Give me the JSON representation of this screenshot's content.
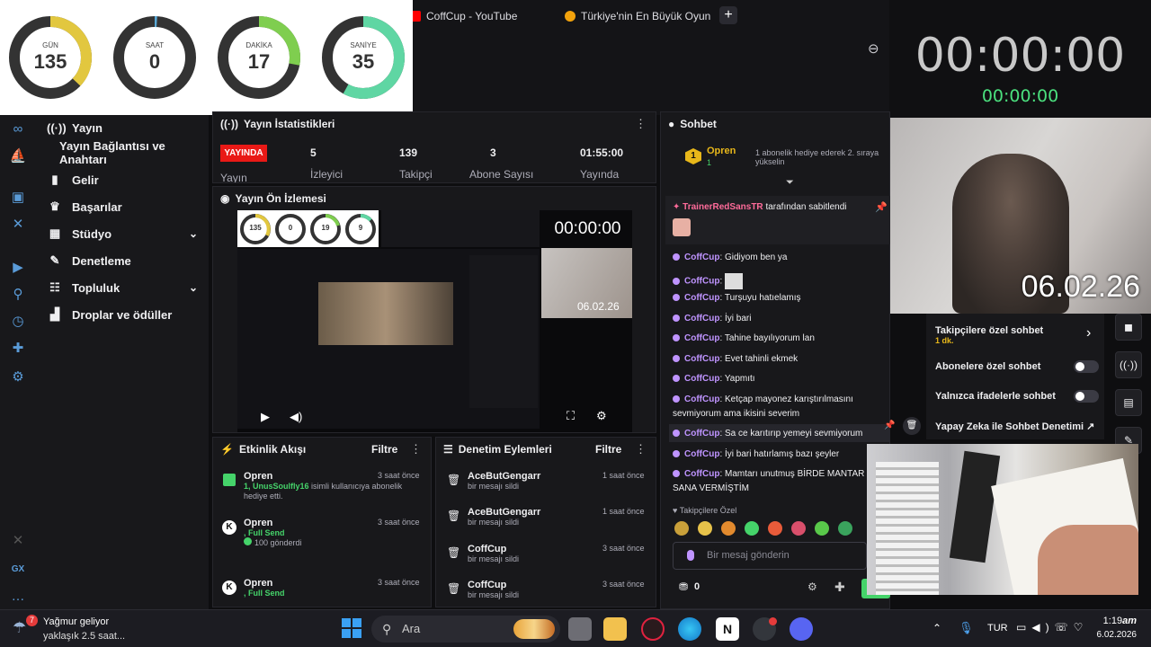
{
  "browser": {
    "tabs": [
      {
        "label": "CoffCup - YouTube",
        "favicon_color": "#ff0000"
      },
      {
        "label": "Türkiye'nin En Büyük Oyun",
        "favicon_color": "#f2a20c"
      }
    ],
    "new_tab": "+",
    "zoom_icon": "zoom-out-icon"
  },
  "countdown": {
    "items": [
      {
        "label": "GÜN",
        "value": "135",
        "fraction": 0.37,
        "color": "#e2c73f"
      },
      {
        "label": "SAAT",
        "value": "0",
        "fraction": 0.01,
        "color": "#5aa9d6"
      },
      {
        "label": "DAKİKA",
        "value": "17",
        "fraction": 0.28,
        "color": "#7fce4f"
      },
      {
        "label": "SANİYE",
        "value": "35",
        "fraction": 0.58,
        "color": "#5fd6a3"
      }
    ]
  },
  "timer": {
    "main": "00:00:00",
    "sub": "00:00:00"
  },
  "webcam": {
    "date": "06.02.26"
  },
  "nav": {
    "items": [
      {
        "label": "Yayın",
        "icon": "broadcast-icon"
      },
      {
        "label": "Yayın Bağlantısı ve Anahtarı",
        "icon": ""
      },
      {
        "label": "Gelir",
        "icon": "money-icon"
      },
      {
        "label": "Başarılar",
        "icon": "trophy-icon"
      },
      {
        "label": "Stüdyo",
        "icon": "studio-icon",
        "chevron": "⌄"
      },
      {
        "label": "Denetleme",
        "icon": "wrench-icon"
      },
      {
        "label": "Topluluk",
        "icon": "community-icon",
        "chevron": "⌄"
      },
      {
        "label": "Droplar ve ödüller",
        "icon": "gift-icon"
      }
    ]
  },
  "stats": {
    "title": "Yayın İstatistikleri",
    "live": "YAYINDA",
    "live_label": "Yayın",
    "items": [
      {
        "value": "5",
        "label": "İzleyici"
      },
      {
        "value": "139",
        "label": "Takipçi"
      },
      {
        "value": "3",
        "label": "Abone Sayısı"
      },
      {
        "value": "01:55:00",
        "label": "Yayında"
      }
    ]
  },
  "preview": {
    "title": "Yayın Ön İzlemesi",
    "inner_timer": "00:00:00",
    "inner_date": "06.02.26",
    "mini_gauges": [
      "135",
      "0",
      "19",
      "9"
    ]
  },
  "feed": {
    "title": "Etkinlik Akışı",
    "filter": "Filtre",
    "items": [
      {
        "name": "Opren",
        "time": "3 saat önce",
        "detail_prefix": "1, ",
        "detail_user": "UnusSoulfly16",
        "detail_rest": " isimli kullanıcıya abonelik hediye etti."
      },
      {
        "name": "Opren",
        "time": "3 saat önce",
        "detail_user": ", Full Send",
        "detail_rest": "100 gönderdi"
      },
      {
        "name": "Opren",
        "time": "3 saat önce",
        "detail_user": ", Full Send",
        "detail_rest": ""
      }
    ]
  },
  "moderation": {
    "title": "Denetim Eylemleri",
    "filter": "Filtre",
    "items": [
      {
        "name": "AceButGengarr",
        "action": "bir mesajı sildi",
        "time": "1 saat önce"
      },
      {
        "name": "AceButGengarr",
        "action": "bir mesajı sildi",
        "time": "1 saat önce"
      },
      {
        "name": "CoffCup",
        "action": "bir mesajı sildi",
        "time": "3 saat önce"
      },
      {
        "name": "CoffCup",
        "action": "bir mesajı sildi",
        "time": "3 saat önce"
      }
    ]
  },
  "chat": {
    "title": "Sohbet",
    "gift_user": "Opren",
    "gift_count": "1",
    "gift_text": "1 abonelik hediye ederek 2. sıraya yükselin",
    "pinned_by": "TrainerRedSansTR",
    "pinned_text": "tarafından sabitlendi",
    "messages": [
      {
        "user": "CoffCup",
        "text": "Gidiyom ben ya"
      },
      {
        "user": "CoffCup",
        "text": ""
      },
      {
        "user": "CoffCup",
        "text": "Turşuyu hatıelamış"
      },
      {
        "user": "CoffCup",
        "text": "İyi bari"
      },
      {
        "user": "CoffCup",
        "text": "Tahine bayılıyorum lan"
      },
      {
        "user": "CoffCup",
        "text": "Evet tahinli ekmek"
      },
      {
        "user": "CoffCup",
        "text": "Yapmıtı"
      },
      {
        "user": "CoffCup",
        "text": "Ketçap mayonez karıştırılmasını"
      },
      {
        "user": "",
        "text": "sevmiyorum ama ikisini severim"
      },
      {
        "user": "CoffCup",
        "text": "Sa   ce karıtırıp yemeyi sevmiyorum"
      },
      {
        "user": "CoffCup",
        "text": "İyi bari hatırlamış bazı şeyler"
      },
      {
        "user": "CoffCup",
        "text": "Mamtarı unutmuş BİRDE MANTAR"
      },
      {
        "user": "",
        "text": "SANA VERMİŞTİM"
      }
    ],
    "followers_only": "Takipçilere Özel",
    "input_placeholder": "Bir mesaj gönderin",
    "points": "0"
  },
  "chat_settings": {
    "rows": [
      {
        "label": "Takipçilere özel sohbet",
        "sub": "1 dk.",
        "control": "›"
      },
      {
        "label": "Abonelere özel sohbet",
        "control": "toggle"
      },
      {
        "label": "Yalnızca ifadelerle sohbet",
        "control": "toggle"
      },
      {
        "label": "Yapay Zeka ile Sohbet Denetimi",
        "control": "↗"
      }
    ]
  },
  "taskbar": {
    "weather_title": "Yağmur geliyor",
    "weather_sub": "yaklaşık 2.5 saat...",
    "weather_badge": "7",
    "search": "Ara",
    "lang": "TUR",
    "time": "1:19",
    "ampm": "am",
    "date": "6.02.2026"
  }
}
